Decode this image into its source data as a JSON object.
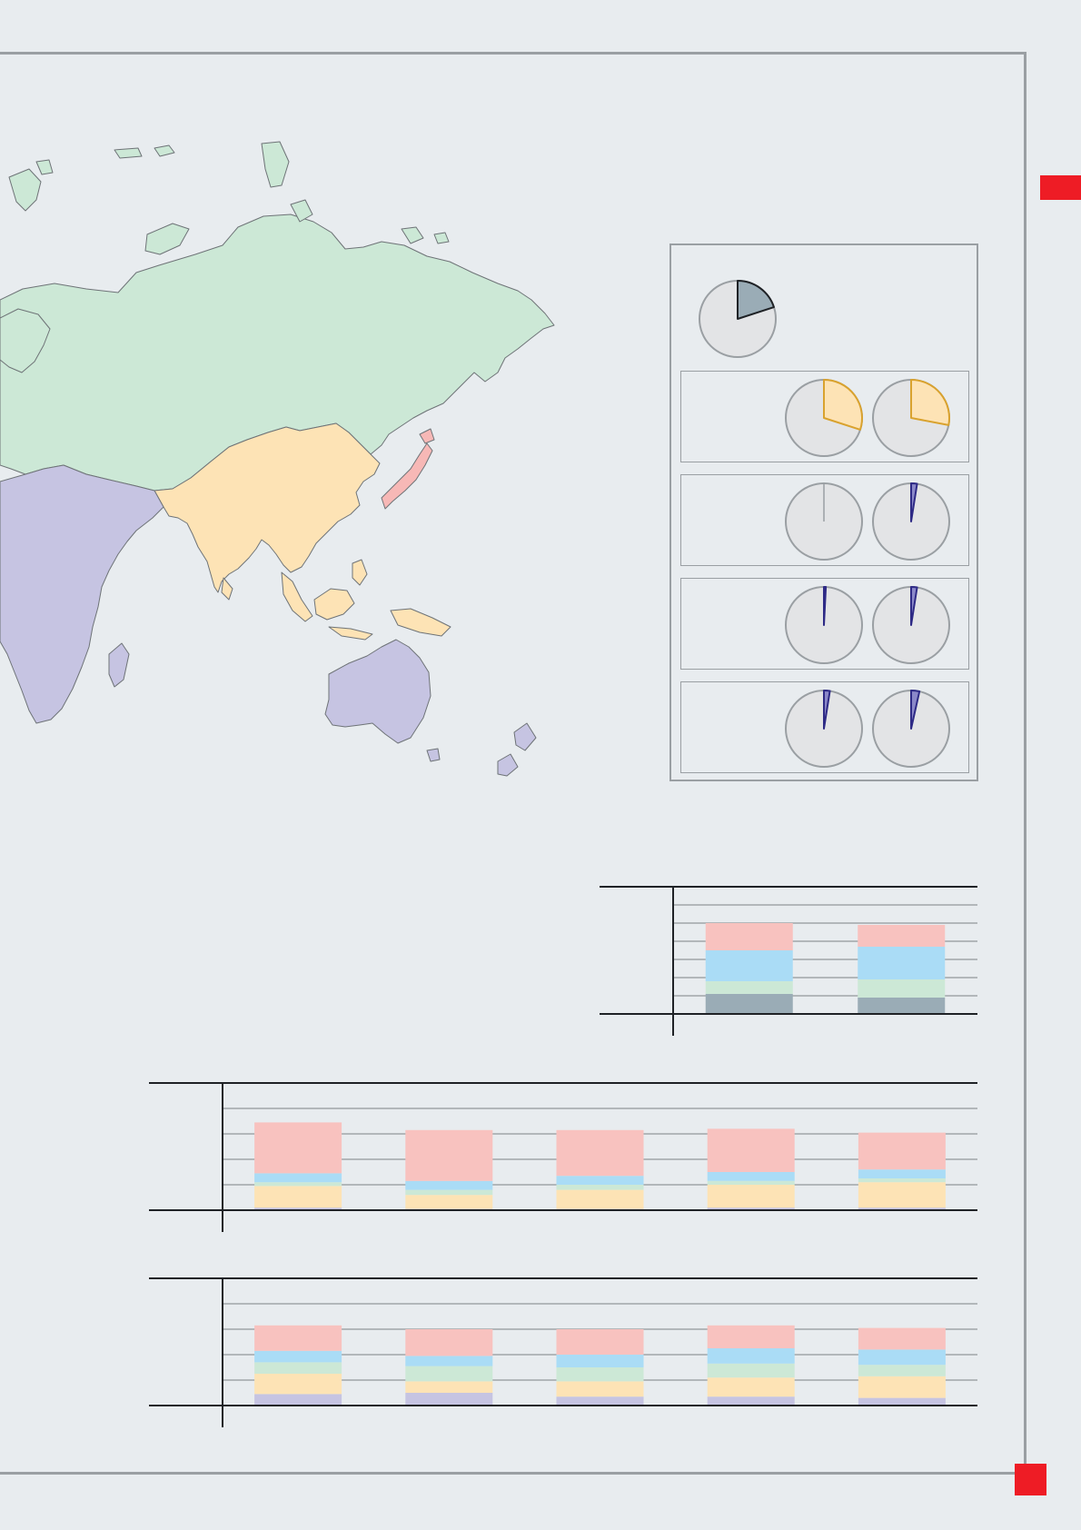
{
  "colors": {
    "accent_red": "#ee1c25",
    "russia_region": "#cce8d6",
    "east_asia_region": "#fde3b5",
    "japan_region": "#f7b8b6",
    "africa_oceania_region": "#c6c4e2",
    "line": "#9a9fa3",
    "pie_background": "#e3e4e6",
    "pie_main_slice": "#9aacb6",
    "pie_orange_slice": "#fde3b5",
    "pie_orange_stroke": "#d9a22e",
    "pie_purple_slice": "#8b88c9",
    "pie_purple_stroke": "#2e2a86"
  },
  "legend": {
    "main_share": 0.2,
    "rows": [
      {
        "left": 0.3,
        "right": 0.28
      },
      {
        "left": 0.0,
        "right": 0.025
      },
      {
        "left": 0.008,
        "right": 0.025
      },
      {
        "left": 0.025,
        "right": 0.035
      }
    ]
  },
  "chart_data": [
    {
      "type": "bar",
      "stacked": true,
      "categories": [
        "",
        ""
      ],
      "ylim": [
        0,
        7
      ],
      "series_colors": [
        "#9aacb6",
        "#cce8d6",
        "#aadcf6",
        "#f8c2bf"
      ],
      "series": [
        {
          "values": [
            1.1,
            0.9
          ]
        },
        {
          "values": [
            0.7,
            1.0
          ]
        },
        {
          "values": [
            1.7,
            1.8
          ]
        },
        {
          "values": [
            1.5,
            1.2
          ]
        }
      ]
    },
    {
      "type": "bar",
      "stacked": true,
      "categories": [
        "",
        "",
        "",
        "",
        ""
      ],
      "ylim": [
        0,
        5
      ],
      "series_colors": [
        "#c6c4e2",
        "#fde3b5",
        "#cce8d6",
        "#aadcf6",
        "#f8c2bf"
      ],
      "series": [
        {
          "values": [
            0.1,
            0.05,
            0.05,
            0.1,
            0.1
          ]
        },
        {
          "values": [
            0.85,
            0.55,
            0.75,
            0.9,
            1.0
          ]
        },
        {
          "values": [
            0.15,
            0.2,
            0.2,
            0.15,
            0.15
          ]
        },
        {
          "values": [
            0.35,
            0.35,
            0.35,
            0.35,
            0.35
          ]
        },
        {
          "values": [
            2.0,
            2.0,
            1.8,
            1.7,
            1.45
          ]
        }
      ]
    },
    {
      "type": "bar",
      "stacked": true,
      "categories": [
        "",
        "",
        "",
        "",
        ""
      ],
      "ylim": [
        0,
        5
      ],
      "series_colors": [
        "#c6c4e2",
        "#fde3b5",
        "#cce8d6",
        "#aadcf6",
        "#f8c2bf"
      ],
      "series": [
        {
          "values": [
            0.45,
            0.5,
            0.35,
            0.35,
            0.3
          ]
        },
        {
          "values": [
            0.8,
            0.45,
            0.6,
            0.75,
            0.85
          ]
        },
        {
          "values": [
            0.45,
            0.6,
            0.55,
            0.55,
            0.45
          ]
        },
        {
          "values": [
            0.45,
            0.4,
            0.5,
            0.6,
            0.6
          ]
        },
        {
          "values": [
            1.0,
            1.05,
            1.0,
            0.9,
            0.85
          ]
        }
      ]
    }
  ]
}
